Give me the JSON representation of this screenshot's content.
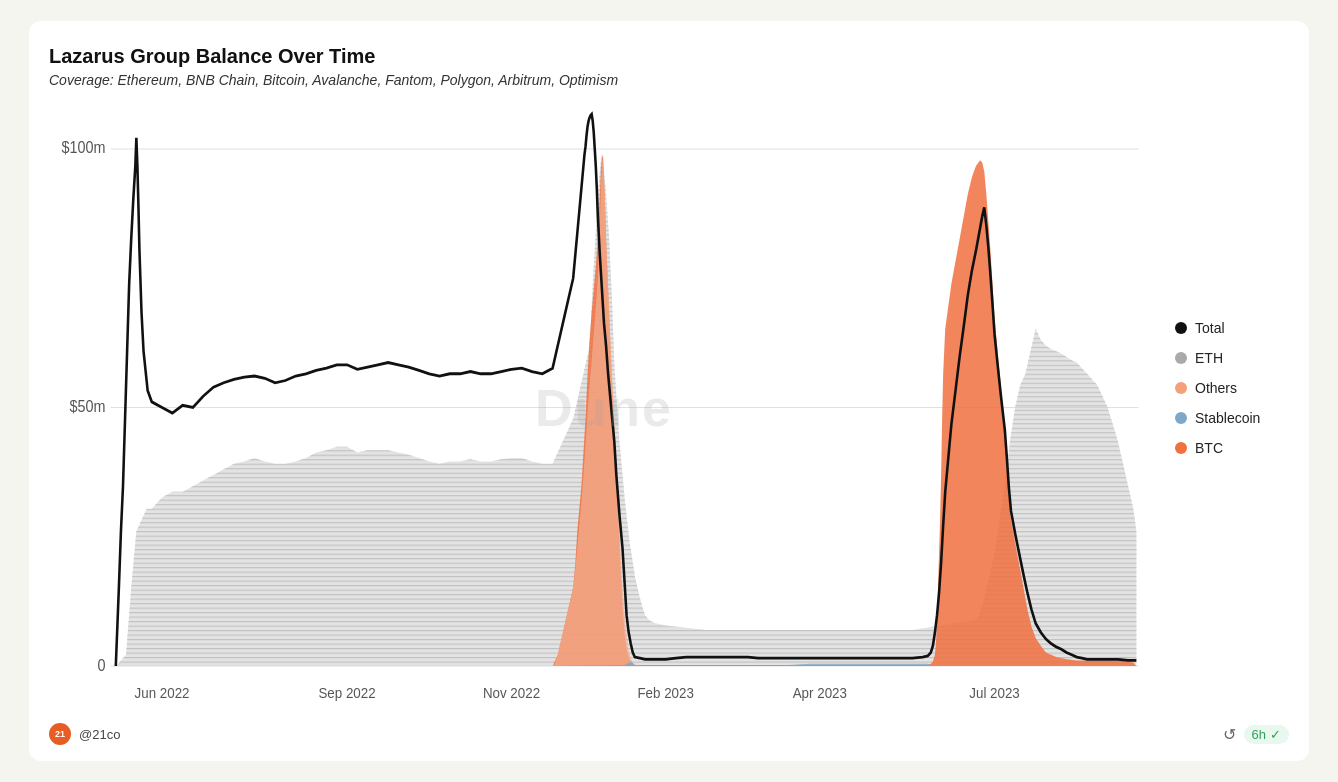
{
  "title": "Lazarus Group Balance Over Time",
  "subtitle": "Coverage: Ethereum, BNB Chain, Bitcoin, Avalanche, Fantom, Polygon, Arbitrum, Optimism",
  "watermark": "Dune",
  "legend": [
    {
      "label": "Total",
      "color": "#111111",
      "id": "total"
    },
    {
      "label": "ETH",
      "color": "#aaaaaa",
      "id": "eth"
    },
    {
      "label": "Others",
      "color": "#f4a07a",
      "id": "others"
    },
    {
      "label": "Stablecoin",
      "color": "#7ea8c9",
      "id": "stablecoin"
    },
    {
      "label": "BTC",
      "color": "#f07040",
      "id": "btc"
    }
  ],
  "y_labels": [
    "$100m",
    "$50m",
    "0"
  ],
  "x_labels": [
    "Jun 2022",
    "Sep 2022",
    "Nov 2022",
    "Feb 2023",
    "Apr 2023",
    "Jul 2023"
  ],
  "footer": {
    "logo_text": "21",
    "handle": "@21co",
    "refresh_label": "6h",
    "check_icon": "✓"
  }
}
